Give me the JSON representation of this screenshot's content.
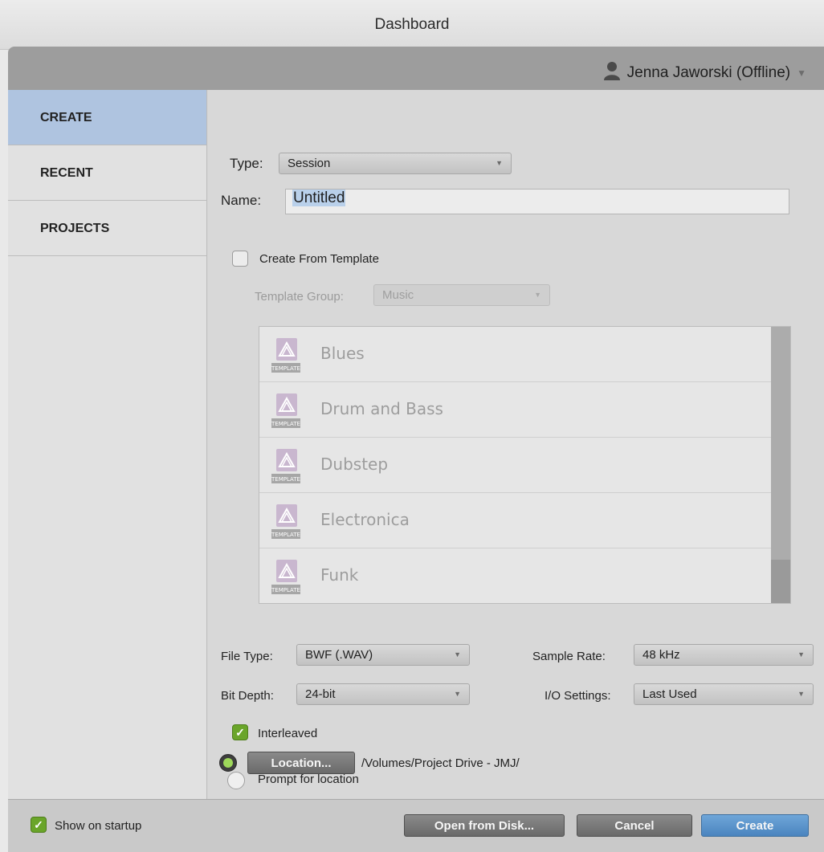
{
  "window": {
    "title": "Dashboard"
  },
  "user": {
    "name": "Jenna Jaworski (Offline)"
  },
  "sidebar": {
    "items": [
      {
        "label": "CREATE",
        "active": true
      },
      {
        "label": "RECENT",
        "active": false
      },
      {
        "label": "PROJECTS",
        "active": false
      }
    ]
  },
  "create": {
    "type_label": "Type:",
    "type_value": "Session",
    "name_label": "Name:",
    "name_value": "Untitled",
    "from_template_label": "Create From Template",
    "from_template_checked": false,
    "template_group_label": "Template Group:",
    "template_group_value": "Music",
    "templates": [
      {
        "name": "Blues",
        "icon": "template-icon"
      },
      {
        "name": "Drum and Bass",
        "icon": "template-icon"
      },
      {
        "name": "Dubstep",
        "icon": "template-icon"
      },
      {
        "name": "Electronica",
        "icon": "template-icon"
      },
      {
        "name": "Funk",
        "icon": "template-icon"
      }
    ],
    "template_icon_text": "TEMPLATE",
    "file_type_label": "File Type:",
    "file_type_value": "BWF (.WAV)",
    "bit_depth_label": "Bit Depth:",
    "bit_depth_value": "24-bit",
    "sample_rate_label": "Sample Rate:",
    "sample_rate_value": "48 kHz",
    "io_settings_label": "I/O Settings:",
    "io_settings_value": "Last Used",
    "interleaved_label": "Interleaved",
    "interleaved_checked": true,
    "prompt_location_label": "Prompt for location",
    "location_button": "Location...",
    "location_path": "/Volumes/Project Drive - JMJ/"
  },
  "footer": {
    "show_on_startup_label": "Show on startup",
    "show_on_startup_checked": true,
    "open_from_disk": "Open from Disk...",
    "cancel": "Cancel",
    "create": "Create"
  },
  "colors": {
    "accent_blue": "#5b93cc",
    "selected_nav": "#afc4e0",
    "radio_green": "#9ed85a",
    "check_green": "#6aa52a"
  }
}
